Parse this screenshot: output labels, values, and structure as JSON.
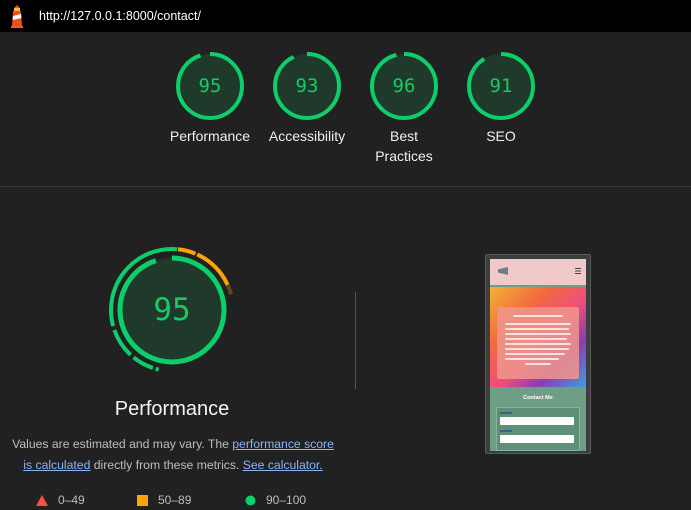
{
  "browser": {
    "url": "http://127.0.0.1:8000/contact/",
    "logo_icon": "lighthouse-icon"
  },
  "categories": [
    {
      "label": "Performance",
      "score": 95
    },
    {
      "label": "Accessibility",
      "score": 93
    },
    {
      "label": "Best Practices",
      "score": 96
    },
    {
      "label": "SEO",
      "score": 91
    }
  ],
  "main": {
    "score": 95,
    "title": "Performance",
    "note_before": "Values are estimated and may vary. The ",
    "note_link1": "performance score is calculated",
    "note_mid": " directly from these metrics. ",
    "note_link2": "See calculator."
  },
  "legend": [
    {
      "shape": "triangle",
      "color": "#ff4e42",
      "range": "0–49"
    },
    {
      "shape": "square",
      "color": "#ffa400",
      "range": "50–89"
    },
    {
      "shape": "circle",
      "color": "#0cce6b",
      "range": "90–100"
    }
  ],
  "preview": {
    "section_heading": "Contact Me"
  },
  "colors": {
    "pass": "#0cce6b",
    "average": "#ffa400",
    "fail": "#ff4e42",
    "background": "#212121"
  }
}
